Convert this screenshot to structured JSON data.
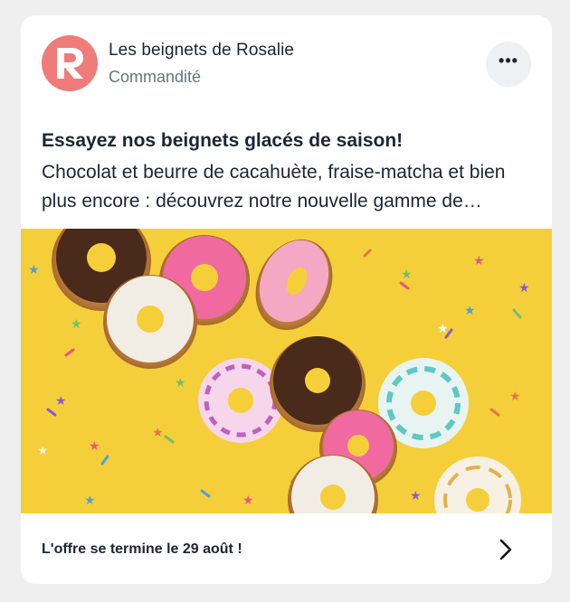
{
  "ad": {
    "advertiser_name": "Les beignets de Rosalie",
    "sponsored_label": "Commandité",
    "avatar_letter": "R",
    "avatar_color": "#ef7b7b",
    "more_label": "•••",
    "headline": "Essayez nos beignets glacés de saison!",
    "body": "Chocolat et beurre de cacahuète, fraise-matcha et bien plus encore : découvrez notre nouvelle gamme de beignets glacés",
    "image_icon": "donuts-photo",
    "image_background": "#f5cf3a",
    "cta_text": "L'offre se termine le 29 août !",
    "cta_icon": "chevron-right-icon"
  }
}
